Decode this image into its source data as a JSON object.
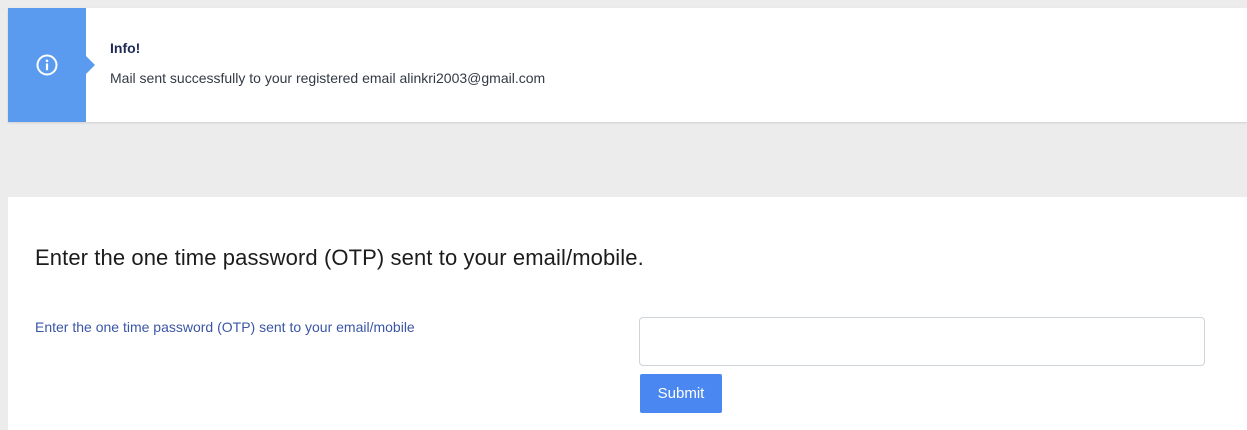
{
  "alert": {
    "icon": "info-circle-icon",
    "title": "Info!",
    "message": "Mail sent successfully to your registered email alinkri2003@gmail.com",
    "accent_color": "#5a9bf0"
  },
  "otp_form": {
    "heading": "Enter the one time password (OTP) sent to your email/mobile.",
    "field_label": "Enter the one time password (OTP) sent to your email/mobile",
    "input_value": "",
    "input_placeholder": "",
    "submit_label": "Submit",
    "submit_color": "#4a87f0"
  }
}
